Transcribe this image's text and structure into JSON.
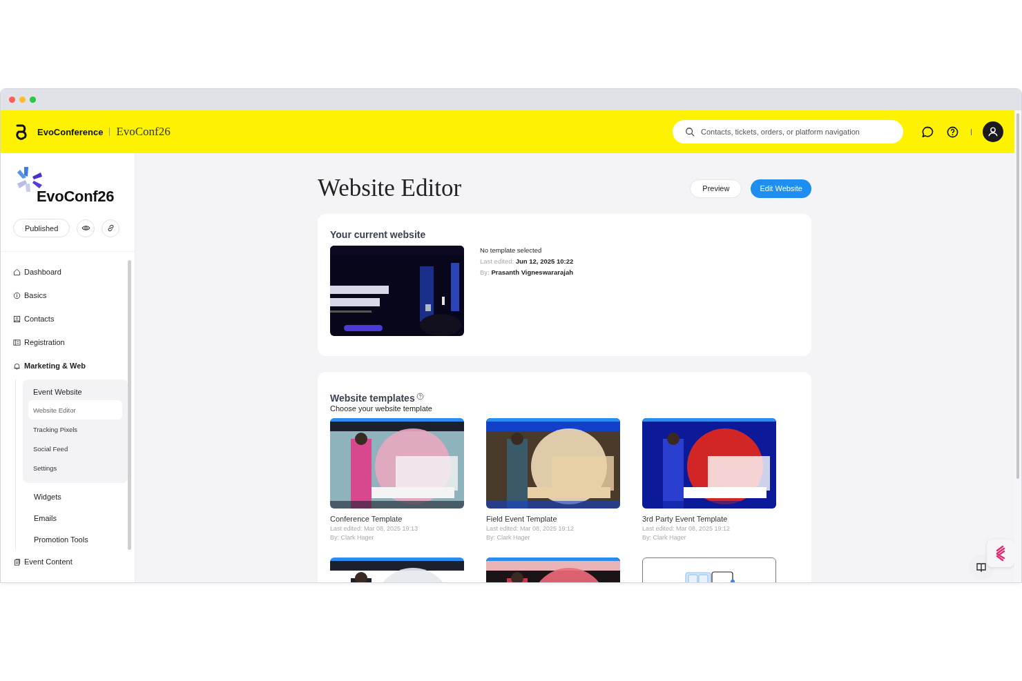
{
  "header": {
    "brand": "EvoConference",
    "event": "EvoConf26",
    "search": {
      "placeholder": "Contacts, tickets, orders, or platform navigation"
    }
  },
  "sidebar": {
    "event_name": "EvoConf26",
    "status": "Published",
    "nav": [
      {
        "label": "Dashboard",
        "selected": false
      },
      {
        "label": "Basics",
        "selected": false
      },
      {
        "label": "Contacts",
        "selected": false
      },
      {
        "label": "Registration",
        "selected": false
      },
      {
        "label": "Marketing & Web",
        "selected": false,
        "expanded": true,
        "children": [
          {
            "label": "Event Website",
            "selected": false,
            "expanded": true,
            "children": [
              {
                "label": "Website Editor",
                "selected": true
              },
              {
                "label": "Tracking Pixels",
                "selected": false
              },
              {
                "label": "Social Feed",
                "selected": false
              },
              {
                "label": "Settings",
                "selected": false
              }
            ]
          },
          {
            "label": "Widgets",
            "selected": false
          },
          {
            "label": "Emails",
            "selected": false
          },
          {
            "label": "Promotion Tools",
            "selected": false
          }
        ]
      },
      {
        "label": "Event Content",
        "selected": false
      }
    ]
  },
  "page": {
    "title": "Website Editor",
    "buttons": [
      {
        "label": "Preview",
        "kind": "secondary"
      },
      {
        "label": "Edit Website",
        "kind": "primary"
      }
    ]
  },
  "current_website": {
    "title": "Your current website",
    "status": "No template selected",
    "edited_label": "Last edited:",
    "edited": "Jun 12, 2025 10:22",
    "by_label": "By:",
    "by": "Prasanth Vigneswararajah"
  },
  "templates": {
    "title": "Website templates",
    "subtitle": "Choose your website template",
    "items": [
      {
        "kind": "picture",
        "name": "Conference Template",
        "edited": "Last edited: Mar 08, 2025 19:13",
        "by": "By: Clark Hager"
      },
      {
        "kind": "picture",
        "name": "Field Event Template",
        "edited": "Last edited: Mar 08, 2025 19:12",
        "by": "By: Clark Hager"
      },
      {
        "kind": "picture",
        "name": "3rd Party Event Template",
        "edited": "Last edited: Mar 08, 2025 19:12",
        "by": "By: Clark Hager"
      },
      {
        "kind": "picture"
      },
      {
        "kind": "picture"
      },
      {
        "kind": "blank"
      }
    ]
  }
}
